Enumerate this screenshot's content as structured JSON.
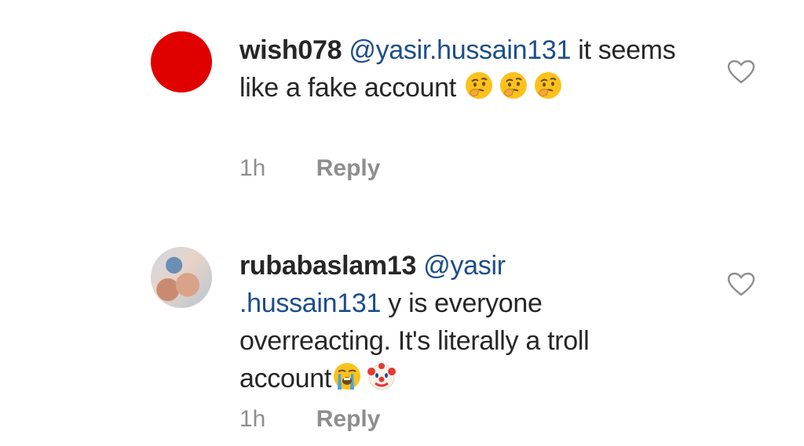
{
  "comments": [
    {
      "username": "wish078",
      "mention": "@yasir.hussain131",
      "text_after_mention": " it seems like a fake account ",
      "emojis": [
        "thinking-face",
        "thinking-face",
        "thinking-face"
      ],
      "time": "1h",
      "reply_label": "Reply",
      "avatar": "red-circle",
      "avatar_color": "#e00000"
    },
    {
      "username": "rubabaslam13",
      "mention": "@yasir .hussain131",
      "text_after_mention": " y is everyone overreacting. It's literally a troll account",
      "emojis": [
        "loudly-crying-face",
        "clown-face"
      ],
      "time": "1h",
      "reply_label": "Reply",
      "avatar": "photo"
    }
  ],
  "colors": {
    "mention": "#1d4e89",
    "text": "#262626",
    "meta": "#8e8e8e",
    "heart_outline": "#8e8e8e"
  }
}
